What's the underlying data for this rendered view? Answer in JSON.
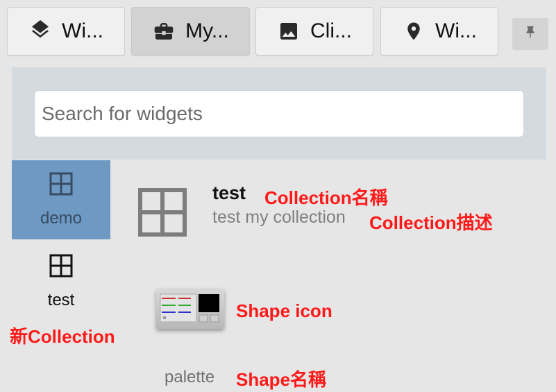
{
  "tabs": [
    {
      "label": "Wi...",
      "icon": "layers-icon",
      "active": false
    },
    {
      "label": "My...",
      "icon": "briefcase-icon",
      "active": true
    },
    {
      "label": "Cli...",
      "icon": "image-icon",
      "active": false
    },
    {
      "label": "Wi...",
      "icon": "location-pin-icon",
      "active": false
    }
  ],
  "pin_icon": "pushpin-icon",
  "search": {
    "placeholder": "Search for widgets",
    "value": ""
  },
  "sidebar": {
    "items": [
      {
        "label": "demo",
        "icon": "grid-icon",
        "selected": true
      },
      {
        "label": "test",
        "icon": "grid-icon",
        "selected": false
      }
    ]
  },
  "collection": {
    "name": "test",
    "description": "test my collection",
    "icon": "grid-icon"
  },
  "shape": {
    "name": "palette",
    "icon": "palette-thumbnail-icon"
  },
  "annotations": {
    "collection_name": "Collection名稱",
    "collection_desc": "Collection描述",
    "new_collection": "新Collection",
    "shape_icon": "Shape icon",
    "shape_name": "Shape名稱"
  },
  "colors": {
    "annotation": "#ff1a1a",
    "selected_sidebar": "#6e99c2",
    "search_band": "#d4dade",
    "background": "#e6e6e6"
  }
}
